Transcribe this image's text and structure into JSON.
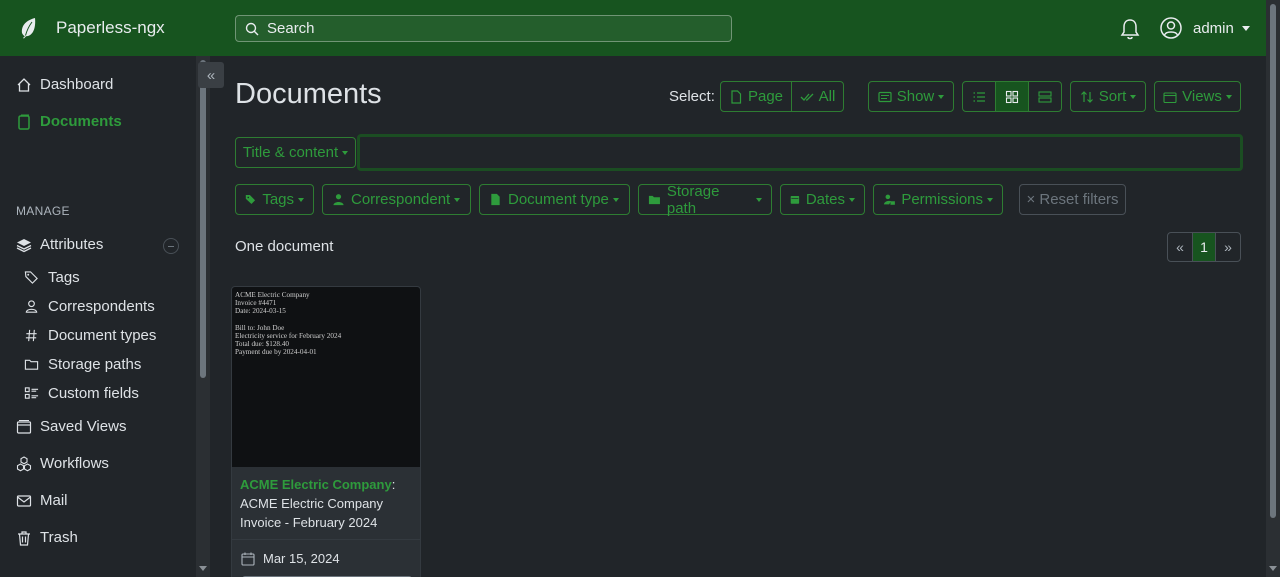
{
  "app": {
    "name": "Paperless-ngx"
  },
  "header": {
    "search_placeholder": "Search",
    "user_name": "admin"
  },
  "sidebar": {
    "items": [
      {
        "label": "Dashboard",
        "active": false
      },
      {
        "label": "Documents",
        "active": true
      }
    ],
    "manage_label": "MANAGE",
    "attributes_label": "Attributes",
    "attribute_items": [
      "Tags",
      "Correspondents",
      "Document types",
      "Storage paths",
      "Custom fields"
    ],
    "bottom_items": [
      "Saved Views",
      "Workflows",
      "Mail",
      "Trash"
    ]
  },
  "main": {
    "title": "Documents",
    "select_label": "Select:",
    "select_page": "Page",
    "select_all": "All",
    "show_label": "Show",
    "sort_label": "Sort",
    "views_label": "Views",
    "title_content_label": "Title & content",
    "query_value": "",
    "filters": [
      "Tags",
      "Correspondent",
      "Document type",
      "Storage path",
      "Dates",
      "Permissions"
    ],
    "reset_label": "× Reset filters",
    "doc_count": "One document",
    "pager": {
      "prev": "«",
      "current": "1",
      "next": "»"
    }
  },
  "document": {
    "thumbnail_lines": [
      "ACME Electric Company",
      "Invoice #4471",
      "Date: 2024-03-15",
      "",
      "Bill to: John Doe",
      "Electricity service for February 2024",
      "Total due: $128.40",
      "Payment due by 2024-04-01"
    ],
    "correspondent": "ACME Electric Company",
    "separator": ":",
    "title": "ACME Electric Company Invoice - February 2024",
    "date": "Mar 15, 2024"
  },
  "colors": {
    "navbar": "#17541f",
    "accent": "#2e9b3c",
    "background": "#212529"
  }
}
